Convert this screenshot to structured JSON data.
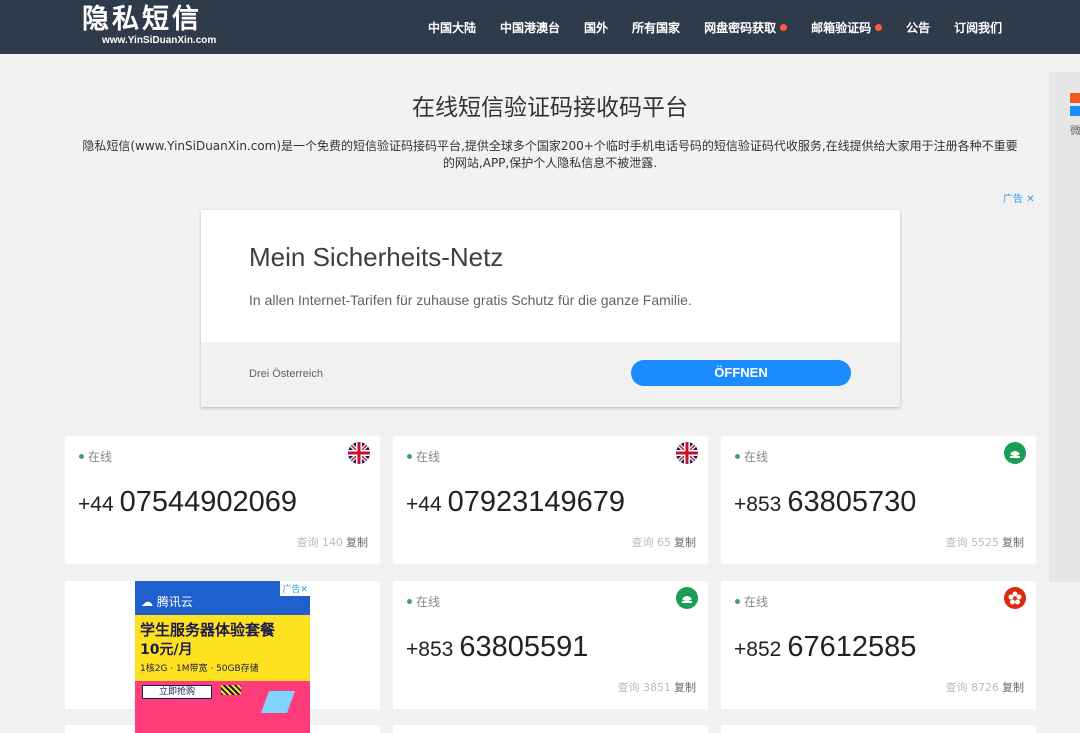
{
  "header": {
    "logo_main": "隐私短信",
    "logo_sub": "www.YinSiDuanXin.com",
    "nav": [
      {
        "label": "中国大陆",
        "dot": false
      },
      {
        "label": "中国港澳台",
        "dot": false
      },
      {
        "label": "国外",
        "dot": false
      },
      {
        "label": "所有国家",
        "dot": false
      },
      {
        "label": "网盘密码获取",
        "dot": true
      },
      {
        "label": "邮箱验证码",
        "dot": true
      },
      {
        "label": "公告",
        "dot": false
      },
      {
        "label": "订阅我们",
        "dot": false
      }
    ]
  },
  "intro": {
    "title": "在线短信验证码接收码平台",
    "description": "隐私短信(www.YinSiDuanXin.com)是一个免费的短信验证码接码平台,提供全球多个国家200+个临时手机电话号码的短信验证码代收服务,在线提供给大家用于注册各种不重要的网站,APP,保护个人隐私信息不被泄露."
  },
  "ad": {
    "label": "广告",
    "headline": "Mein Sicherheits-Netz",
    "description": "In allen Internet-Tarifen für zuhause gratis Schutz für die ganze Familie.",
    "advertiser": "Drei Österreich",
    "button": "ÖFFNEN"
  },
  "side_ad": {
    "text": "微"
  },
  "tencent_ad": {
    "label": "广告",
    "brand": "腾讯云",
    "headline": "学生服务器体验套餐",
    "price": "10元/月",
    "spec": "1核2G · 1M带宽 · 50GB存储",
    "button": "立即抢购"
  },
  "cards": [
    {
      "status": "在线",
      "cc": "+44",
      "number": "07544902069",
      "query_label": "查询",
      "count": "140",
      "copy": "复制",
      "flag": "uk"
    },
    {
      "status": "在线",
      "cc": "+44",
      "number": "07923149679",
      "query_label": "查询",
      "count": "65",
      "copy": "复制",
      "flag": "uk"
    },
    {
      "status": "在线",
      "cc": "+853",
      "number": "63805730",
      "query_label": "查询",
      "count": "5525",
      "copy": "复制",
      "flag": "macau"
    },
    {
      "status": "在线",
      "cc": "+853",
      "number": "63805591",
      "query_label": "查询",
      "count": "3851",
      "copy": "复制",
      "flag": "macau"
    },
    {
      "status": "在线",
      "cc": "+852",
      "number": "67612585",
      "query_label": "查询",
      "count": "8726",
      "copy": "复制",
      "flag": "hongkong"
    }
  ],
  "colors": {
    "header_bg": "#2f3b4b",
    "online_dot": "#3aa17e",
    "ad_button": "#1a8cff",
    "nav_dot": "#ff5a3c"
  }
}
